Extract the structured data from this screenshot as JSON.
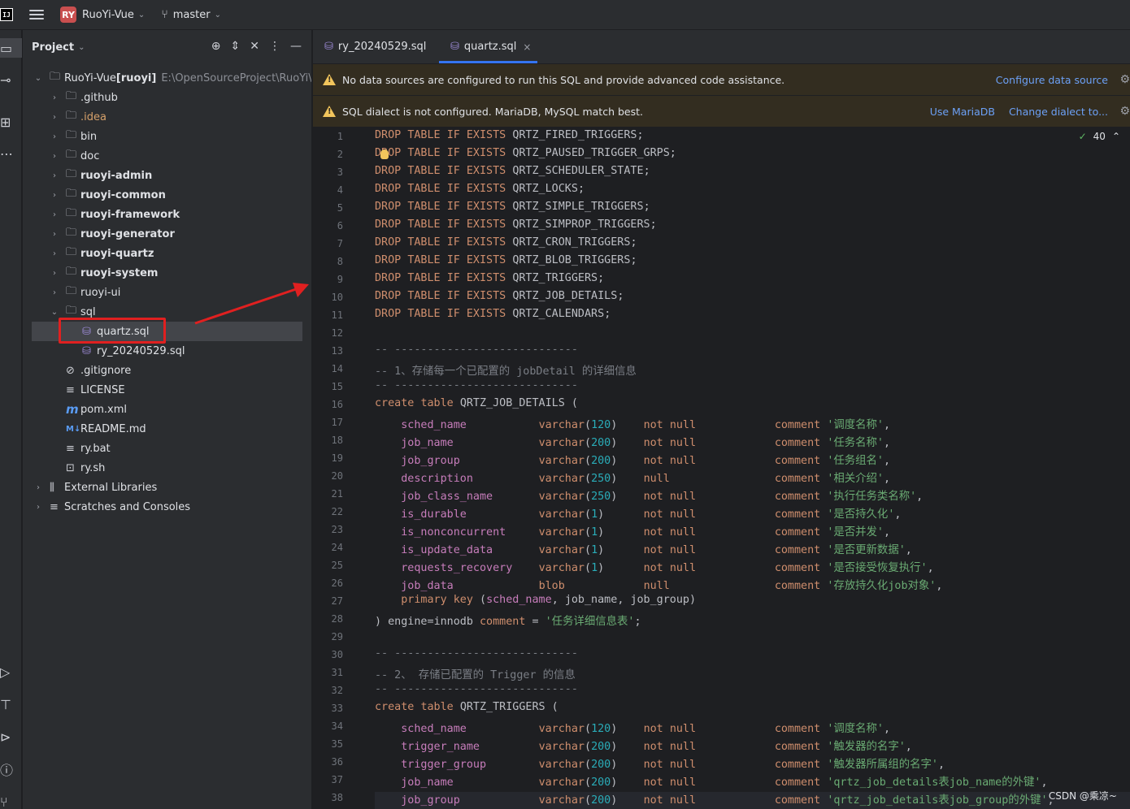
{
  "titlebar": {
    "app_logo": "IJ",
    "project_badge": "RY",
    "project_name": "RuoYi-Vue",
    "branch": "master"
  },
  "project_panel": {
    "title": "Project",
    "tree": [
      {
        "label": "RuoYi-Vue",
        "suffix": "[ruoyi]",
        "path": "E:\\OpenSourceProject\\RuoYi\\RuoYi-Vue",
        "level": 0,
        "expanded": true,
        "icon": "module-folder-icon"
      },
      {
        "label": ".github",
        "level": 1,
        "icon": "folder-icon"
      },
      {
        "label": ".idea",
        "level": 1,
        "icon": "folder-icon",
        "color": "orange"
      },
      {
        "label": "bin",
        "level": 1,
        "icon": "folder-icon"
      },
      {
        "label": "doc",
        "level": 1,
        "icon": "folder-icon"
      },
      {
        "label": "ruoyi-admin",
        "level": 1,
        "icon": "module-folder-icon",
        "bold": true
      },
      {
        "label": "ruoyi-common",
        "level": 1,
        "icon": "module-folder-icon",
        "bold": true
      },
      {
        "label": "ruoyi-framework",
        "level": 1,
        "icon": "module-folder-icon",
        "bold": true
      },
      {
        "label": "ruoyi-generator",
        "level": 1,
        "icon": "module-folder-icon",
        "bold": true
      },
      {
        "label": "ruoyi-quartz",
        "level": 1,
        "icon": "module-folder-icon",
        "bold": true
      },
      {
        "label": "ruoyi-system",
        "level": 1,
        "icon": "module-folder-icon",
        "bold": true
      },
      {
        "label": "ruoyi-ui",
        "level": 1,
        "icon": "folder-icon"
      },
      {
        "label": "sql",
        "level": 1,
        "icon": "folder-icon",
        "expanded": true
      },
      {
        "label": "quartz.sql",
        "level": 2,
        "icon": "database-file-icon",
        "selected": true
      },
      {
        "label": "ry_20240529.sql",
        "level": 2,
        "icon": "database-file-icon"
      },
      {
        "label": ".gitignore",
        "level": 1,
        "icon": "ignore-file-icon"
      },
      {
        "label": "LICENSE",
        "level": 1,
        "icon": "text-file-icon"
      },
      {
        "label": "pom.xml",
        "level": 1,
        "icon": "maven-icon"
      },
      {
        "label": "README.md",
        "level": 1,
        "icon": "markdown-icon"
      },
      {
        "label": "ry.bat",
        "level": 1,
        "icon": "text-file-icon"
      },
      {
        "label": "ry.sh",
        "level": 1,
        "icon": "shell-file-icon"
      },
      {
        "label": "External Libraries",
        "level": 0,
        "icon": "library-icon"
      },
      {
        "label": "Scratches and Consoles",
        "level": 0,
        "icon": "scratches-icon"
      }
    ]
  },
  "editor": {
    "tabs": [
      {
        "label": "ry_20240529.sql",
        "active": false
      },
      {
        "label": "quartz.sql",
        "active": true
      }
    ],
    "banners": [
      {
        "text": "No data sources are configured to run this SQL and provide advanced code assistance.",
        "links": [
          "Configure data source"
        ]
      },
      {
        "text": "SQL dialect is not configured. MariaDB, MySQL match best.",
        "links": [
          "Use MariaDB",
          "Change dialect to..."
        ]
      }
    ],
    "inspection_count": "40",
    "lines": [
      "DROP TABLE IF EXISTS QRTZ_FIRED_TRIGGERS;",
      "DROP TABLE IF EXISTS QRTZ_PAUSED_TRIGGER_GRPS;",
      "DROP TABLE IF EXISTS QRTZ_SCHEDULER_STATE;",
      "DROP TABLE IF EXISTS QRTZ_LOCKS;",
      "DROP TABLE IF EXISTS QRTZ_SIMPLE_TRIGGERS;",
      "DROP TABLE IF EXISTS QRTZ_SIMPROP_TRIGGERS;",
      "DROP TABLE IF EXISTS QRTZ_CRON_TRIGGERS;",
      "DROP TABLE IF EXISTS QRTZ_BLOB_TRIGGERS;",
      "DROP TABLE IF EXISTS QRTZ_TRIGGERS;",
      "DROP TABLE IF EXISTS QRTZ_JOB_DETAILS;",
      "DROP TABLE IF EXISTS QRTZ_CALENDARS;",
      "",
      "-- ----------------------------",
      "-- 1、存储每一个已配置的 jobDetail 的详细信息",
      "-- ----------------------------",
      "create table QRTZ_JOB_DETAILS (",
      "    sched_name           varchar(120)    not null            comment '调度名称',",
      "    job_name             varchar(200)    not null            comment '任务名称',",
      "    job_group            varchar(200)    not null            comment '任务组名',",
      "    description          varchar(250)    null                comment '相关介绍',",
      "    job_class_name       varchar(250)    not null            comment '执行任务类名称',",
      "    is_durable           varchar(1)      not null            comment '是否持久化',",
      "    is_nonconcurrent     varchar(1)      not null            comment '是否并发',",
      "    is_update_data       varchar(1)      not null            comment '是否更新数据',",
      "    requests_recovery    varchar(1)      not null            comment '是否接受恢复执行',",
      "    job_data             blob            null                comment '存放持久化job对象',",
      "    primary key (sched_name, job_name, job_group)",
      ") engine=innodb comment = '任务详细信息表';",
      "",
      "-- ----------------------------",
      "-- 2、 存储已配置的 Trigger 的信息",
      "-- ----------------------------",
      "create table QRTZ_TRIGGERS (",
      "    sched_name           varchar(120)    not null            comment '调度名称',",
      "    trigger_name         varchar(200)    not null            comment '触发器的名字',",
      "    trigger_group        varchar(200)    not null            comment '触发器所属组的名字',",
      "    job_name             varchar(200)    not null            comment 'qrtz_job_details表job_name的外键',",
      "    job_group            varchar(200)    not null            comment 'qrtz_job_details表job_group的外键',"
    ]
  },
  "watermark": "CSDN @乘凉~"
}
